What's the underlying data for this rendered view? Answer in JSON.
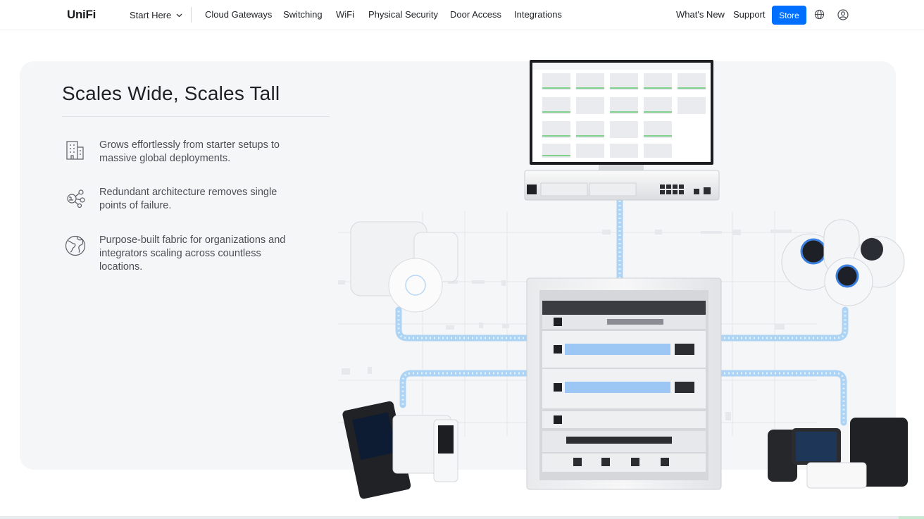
{
  "nav": {
    "logo": "UniFi",
    "items": [
      {
        "label": "Start Here",
        "has_dropdown": true
      },
      {
        "label": "Cloud Gateways"
      },
      {
        "label": "Switching"
      },
      {
        "label": "WiFi"
      },
      {
        "label": "Physical Security"
      },
      {
        "label": "Door Access"
      },
      {
        "label": "Integrations"
      }
    ],
    "right": {
      "whats_new": "What's New",
      "support": "Support",
      "store": "Store",
      "icons": [
        "globe-icon",
        "user-account-icon"
      ]
    }
  },
  "hero": {
    "heading": "Scales Wide, Scales Tall",
    "features": [
      {
        "icon": "building-icon",
        "text": "Grows effortlessly from starter setups to massive global deployments."
      },
      {
        "icon": "network-nodes-icon",
        "text": "Redundant architecture removes single points of failure."
      },
      {
        "icon": "globe-icon",
        "text": "Purpose-built fabric for organizations and integrators scaling across countless locations."
      }
    ]
  },
  "colors": {
    "accent": "#006fff",
    "card_bg": "#f5f6f7",
    "fiber": "#8fc3f0"
  }
}
